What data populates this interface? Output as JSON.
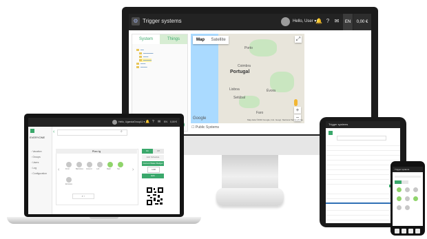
{
  "monitor": {
    "app_title": "Trigger systems",
    "user_label": "Hello, User ▾",
    "icons": [
      "bell-icon",
      "help-icon",
      "chat-icon"
    ],
    "lang": "EN",
    "balance": "0,00 €",
    "side_tabs": [
      "System",
      "Things"
    ],
    "map_tabs": [
      "Map",
      "Satellite"
    ],
    "map_country": "Portugal",
    "map_cities": [
      "Lisboa",
      "Porto",
      "Coimbra",
      "Évora",
      "Faro",
      "Setúbal"
    ],
    "map_footer": "Map data ©2016 Google, Inst. Geogr. Nacional   Terms of Use",
    "google_logo": "Google",
    "public_systems": "Public Systems",
    "zoom_in": "+",
    "zoom_out": "−"
  },
  "laptop": {
    "user_label": "Hello, UgandaGroup11 ▾",
    "brand": "EVERYONE",
    "nav": [
      "Vacation",
      "Groups",
      "Users",
      "Log",
      "Configuration"
    ],
    "panel_title": "Plan tg",
    "dot_labels": [
      "Front",
      "Balconies",
      "Ground",
      "Left",
      "Right",
      "Top",
      "Entrance"
    ],
    "right_buttons": [
      "On",
      "Off",
      "Add Schedule",
      "Current Water Budget",
      "Edit"
    ],
    "right_value": "1:40"
  },
  "tablet": {
    "title": "Trigger systems"
  },
  "phone": {
    "title": "Trigger systems"
  },
  "colors": {
    "accent_green": "#3aa86b",
    "dot_green": "#8fd46b",
    "dot_grey": "#c7c7c7",
    "dark_bar": "#232323"
  }
}
